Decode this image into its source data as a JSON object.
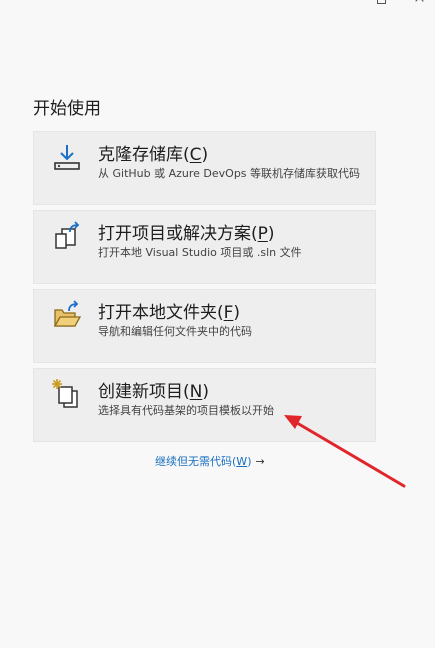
{
  "heading": "开始使用",
  "cards": [
    {
      "title": "克隆存储库",
      "hotkey": "C",
      "description": "从 GitHub 或 Azure DevOps 等联机存储库获取代码",
      "icon": "clone-download-icon"
    },
    {
      "title": "打开项目或解决方案",
      "hotkey": "P",
      "description": "打开本地 Visual Studio 项目或 .sln 文件",
      "icon": "open-project-icon"
    },
    {
      "title": "打开本地文件夹",
      "hotkey": "F",
      "description": "导航和编辑任何文件夹中的代码",
      "icon": "open-folder-icon"
    },
    {
      "title": "创建新项目",
      "hotkey": "N",
      "description": "选择具有代码基架的项目模板以开始",
      "icon": "new-project-icon"
    }
  ],
  "continue_link": {
    "label": "继续但无需代码",
    "hotkey": "W",
    "arrow": "→"
  },
  "colors": {
    "link": "#1a6fbf",
    "card_bg": "#efeeee",
    "annotation_arrow": "#e0262b"
  }
}
